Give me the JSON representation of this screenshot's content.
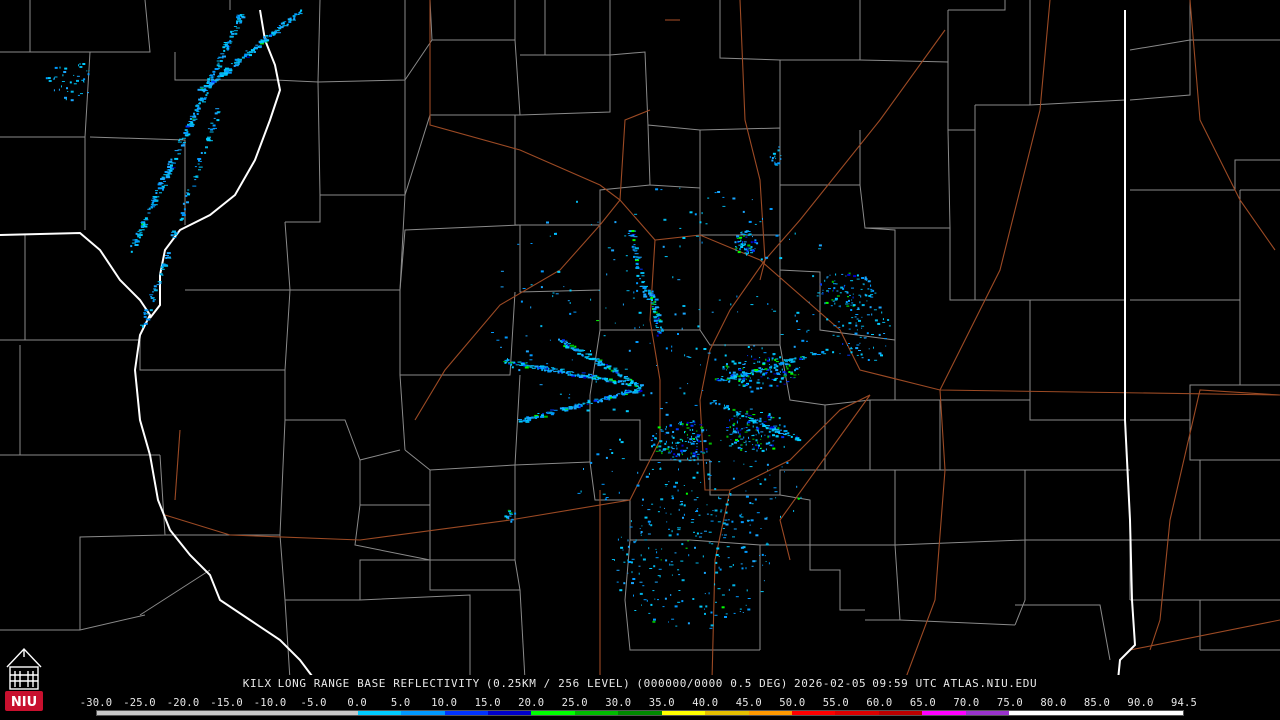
{
  "product": {
    "station": "KILX",
    "title": "LONG RANGE BASE REFLECTIVITY",
    "resolution": "(0.25KM / 256 LEVEL)",
    "volume": "(000000/0000 0.5 DEG)",
    "date": "2026-02-05",
    "time": "09:59 UTC",
    "source": "ATLAS.NIU.EDU"
  },
  "logo": {
    "text": "NIU",
    "color": "#c8102e"
  },
  "colors": {
    "background": "#000000",
    "county_lines": "#8a8a8a",
    "state_lines": "#ffffff",
    "highways": "#9c4a24"
  },
  "scale": {
    "ticks": [
      "-30.0",
      "-25.0",
      "-20.0",
      "-15.0",
      "-10.0",
      "-5.0",
      "0.0",
      "5.0",
      "10.0",
      "15.0",
      "20.0",
      "25.0",
      "30.0",
      "35.0",
      "40.0",
      "45.0",
      "50.0",
      "55.0",
      "60.0",
      "65.0",
      "70.0",
      "75.0",
      "80.0",
      "85.0",
      "90.0",
      "94.5"
    ],
    "colors": [
      "#c8c8c8",
      "#c8c8c8",
      "#c8c8c8",
      "#c8c8c8",
      "#c8c8c8",
      "#c8c8c8",
      "#00ccff",
      "#0099ff",
      "#0033ff",
      "#0000cc",
      "#00ff00",
      "#00bb00",
      "#008800",
      "#ffff00",
      "#e6c000",
      "#ff9900",
      "#ff0000",
      "#dd0000",
      "#bb0000",
      "#ff00ff",
      "#9933cc",
      "#ffffff",
      "#ffffff",
      "#ffffff",
      "#ffffff"
    ]
  }
}
